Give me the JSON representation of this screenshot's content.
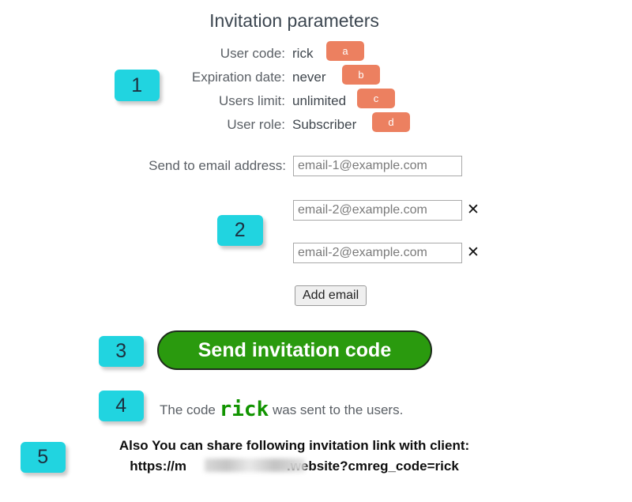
{
  "page": {
    "title": "Invitation parameters"
  },
  "parameters": {
    "rows": [
      {
        "label": "User code:",
        "value": "rick",
        "badge": "a"
      },
      {
        "label": "Expiration date:",
        "value": "never",
        "badge": "b"
      },
      {
        "label": "Users limit:",
        "value": "unlimited",
        "badge": "c"
      },
      {
        "label": "User role:",
        "value": "Subscriber",
        "badge": "d"
      }
    ]
  },
  "email_section": {
    "label": "Send to email address:",
    "primary_value": "email-1@example.com",
    "extra_rows": [
      {
        "value": "email-2@example.com",
        "remove_icon": "✕"
      },
      {
        "value": "email-2@example.com",
        "remove_icon": "✕"
      }
    ],
    "add_button_label": "Add email"
  },
  "send_button": {
    "label": "Send invitation code"
  },
  "confirmation": {
    "prefix": "The code ",
    "code": "rick",
    "suffix": " was sent to the users."
  },
  "share": {
    "heading": "Also You can share following invitation link with client:",
    "url_prefix": "https://m",
    "url_redacted": "",
    "url_suffix": ".website?cmreg_code=rick"
  },
  "annotations": {
    "numbers": [
      "1",
      "2",
      "3",
      "4",
      "5"
    ],
    "letters": [
      "a",
      "b",
      "c",
      "d"
    ],
    "colors": {
      "number_badge": "#21D4E0",
      "letter_badge": "#EC8060",
      "send_button": "#2A9A0E",
      "code_text": "#119400"
    }
  }
}
